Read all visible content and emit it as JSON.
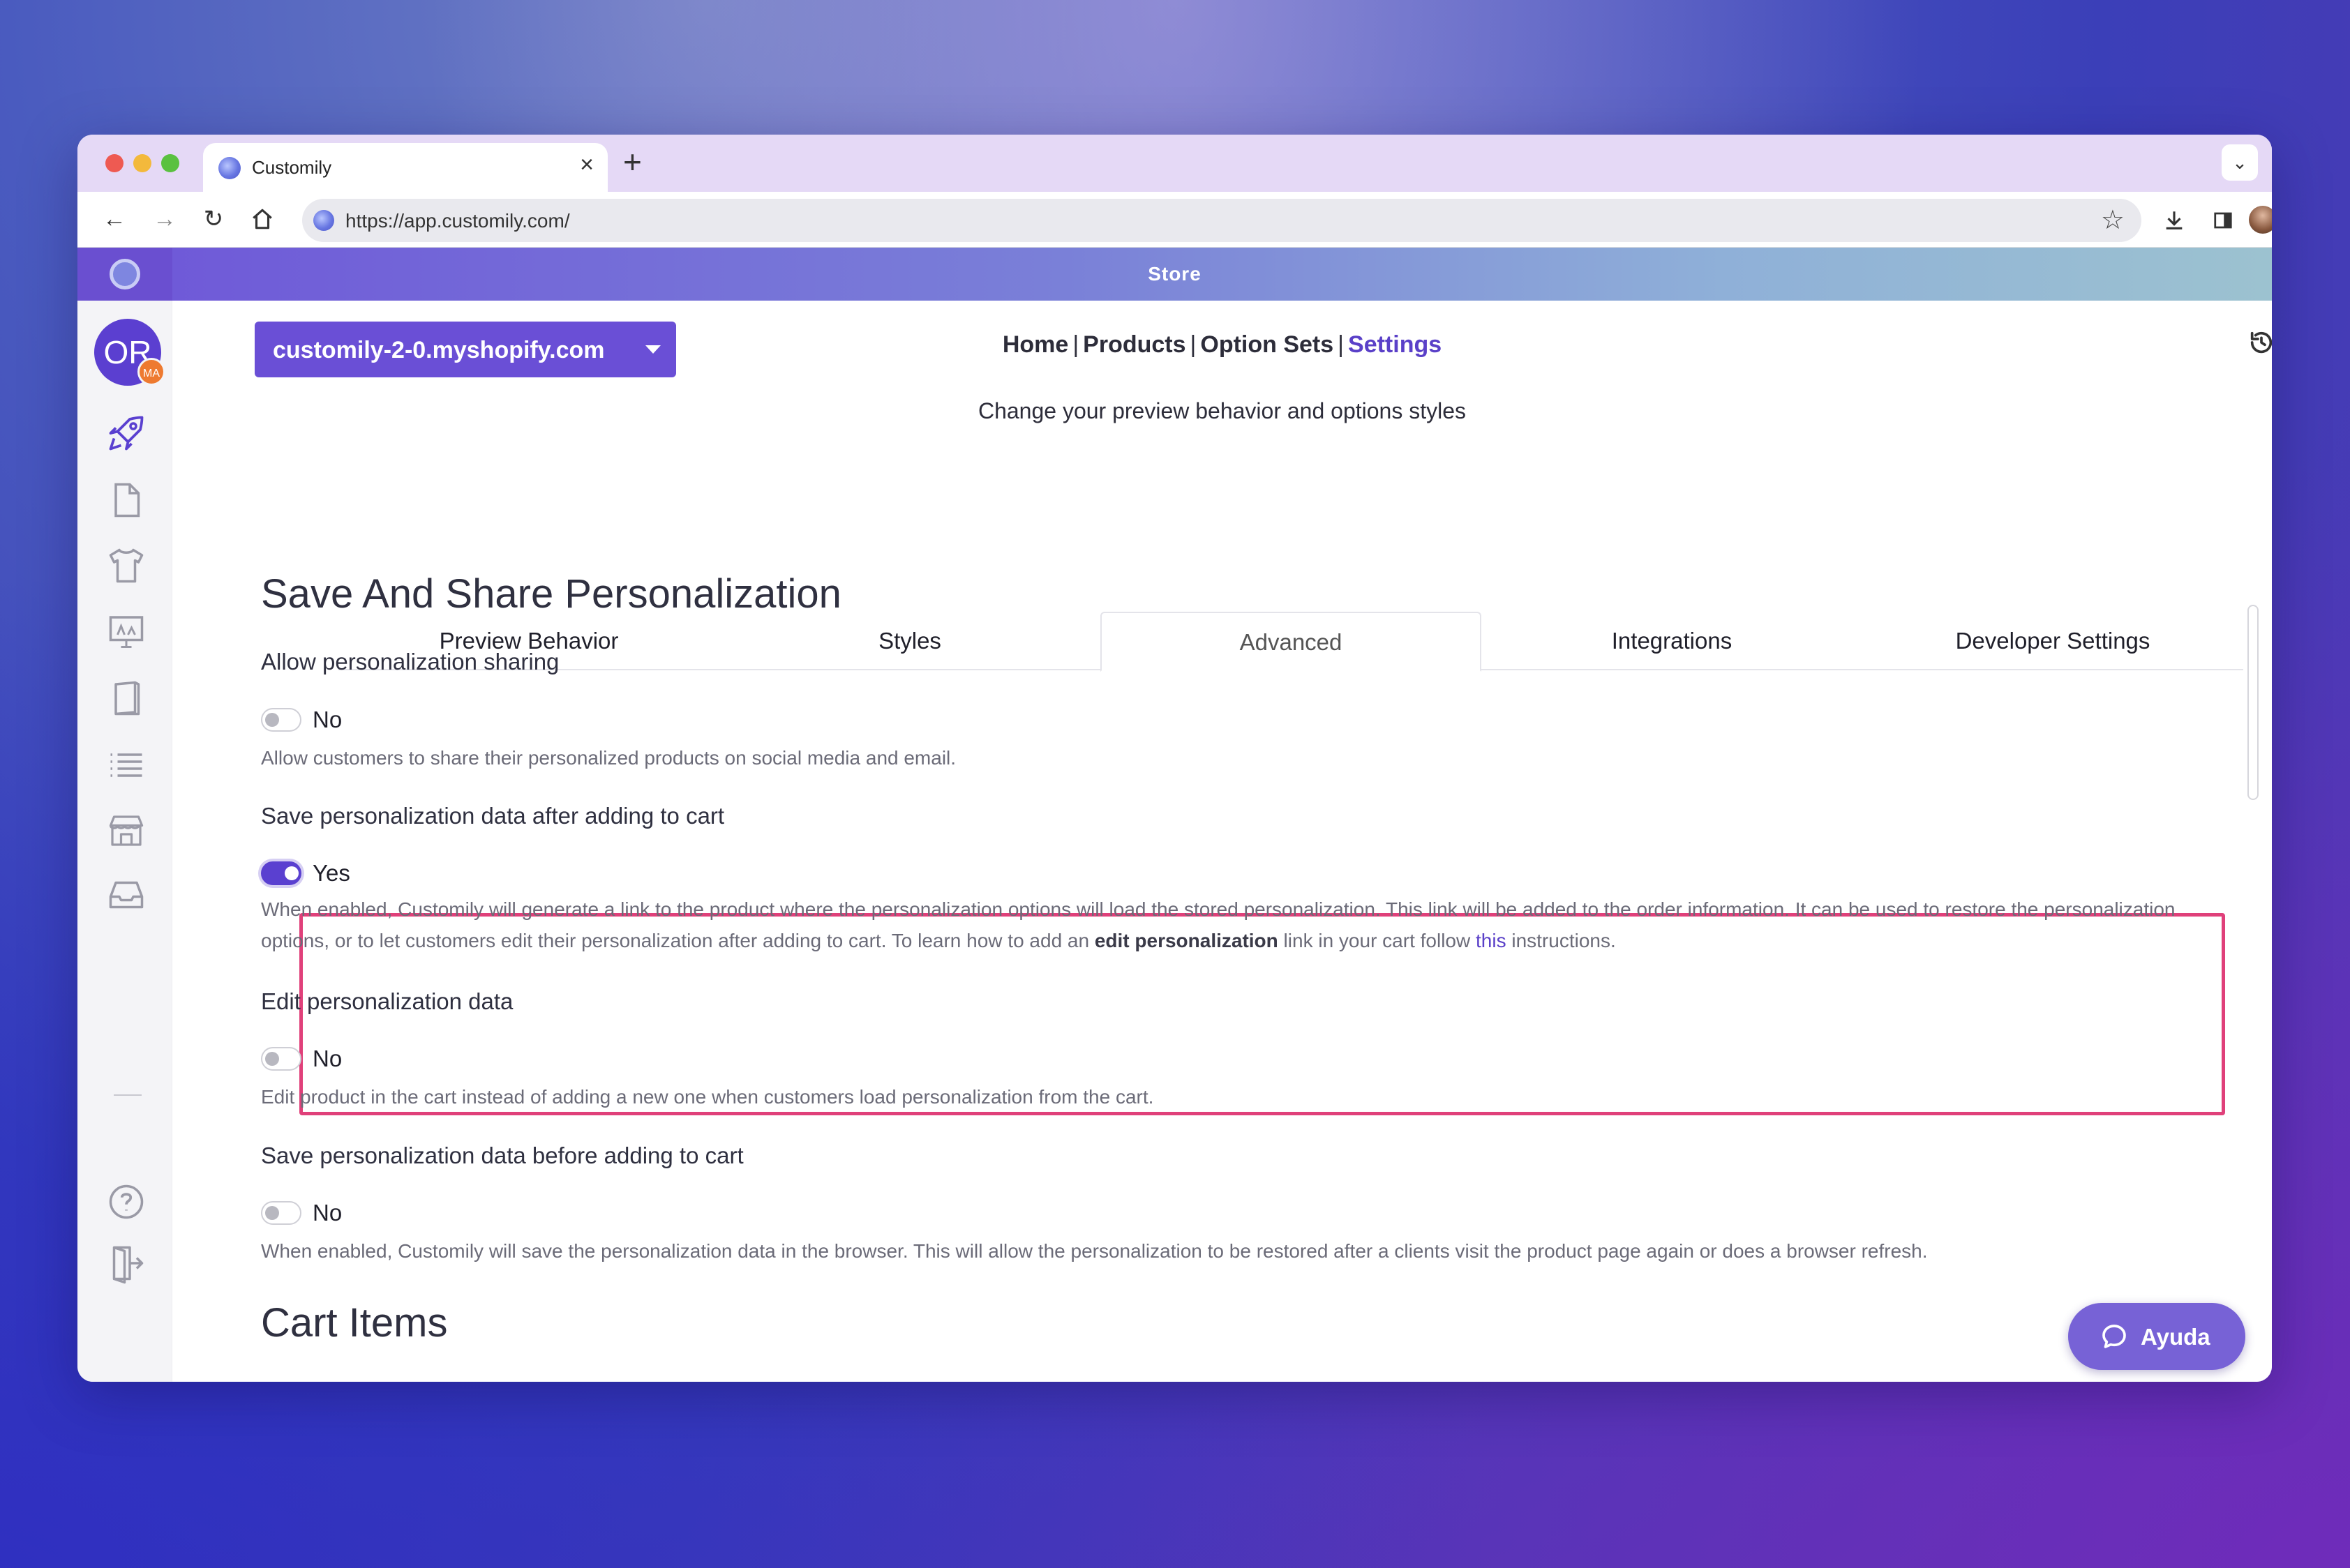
{
  "browser": {
    "tab_title": "Customily",
    "tab_close": "×",
    "new_tab": "+",
    "url": "https://app.customily.com/",
    "icons": [
      "back-icon",
      "forward-icon",
      "reload-icon",
      "home-icon",
      "star-icon",
      "download-icon",
      "side-panel-icon",
      "profile-avatar",
      "more-icon"
    ]
  },
  "app_bar": {
    "title": "Store"
  },
  "sidebar": {
    "avatar_initials": "OR",
    "avatar_badge": "MA",
    "items": [
      "rocket-icon",
      "document-icon",
      "tshirt-icon",
      "monitor-icon",
      "book-icon",
      "list-icon",
      "store-icon",
      "inbox-icon"
    ],
    "bottom_items": [
      "help-icon",
      "logout-icon"
    ]
  },
  "header": {
    "store_name": "customily-2-0.myshopify.com",
    "nav": {
      "home": "Home",
      "products": "Products",
      "option_sets": "Option Sets",
      "settings": "Settings",
      "separator": "|"
    },
    "subtitle": "Change your preview behavior and options styles"
  },
  "tabs": {
    "preview_behavior": "Preview Behavior",
    "styles": "Styles",
    "advanced": "Advanced",
    "integrations": "Integrations",
    "developer_settings": "Developer Settings",
    "active": "Advanced"
  },
  "section_save_share": {
    "title": "Save And Share Personalization",
    "settings": [
      {
        "label": "Allow personalization sharing",
        "state": "No",
        "on": false,
        "help": "Allow customers to share their personalized products on social media and email."
      },
      {
        "label": "Save personalization data after adding to cart",
        "state": "Yes",
        "on": true,
        "help_part1": "When enabled, Customily will generate a link to the product where the personalization options will load the stored personalization. This link will be added to the order information. It can be used to restore the personalization options, or to let customers edit their personalization after adding to cart. To learn how to add an ",
        "help_bold": "edit personalization",
        "help_part2": " link in your cart follow ",
        "help_link": "this",
        "help_part3": " instructions."
      },
      {
        "label": "Edit personalization data",
        "state": "No",
        "on": false,
        "help": "Edit product in the cart instead of adding a new one when customers load personalization from the cart."
      },
      {
        "label": "Save personalization data before adding to cart",
        "state": "No",
        "on": false,
        "help": "When enabled, Customily will save the personalization data in the browser. This will allow the personalization to be restored after a clients visit the product page again or does a browser refresh."
      }
    ]
  },
  "section_cart_items": {
    "title": "Cart Items"
  },
  "chat_button": {
    "label": "Ayuda"
  },
  "colors": {
    "brand": "#6a4fd6",
    "highlight_border": "#e0407a",
    "link": "#5a40c8"
  }
}
